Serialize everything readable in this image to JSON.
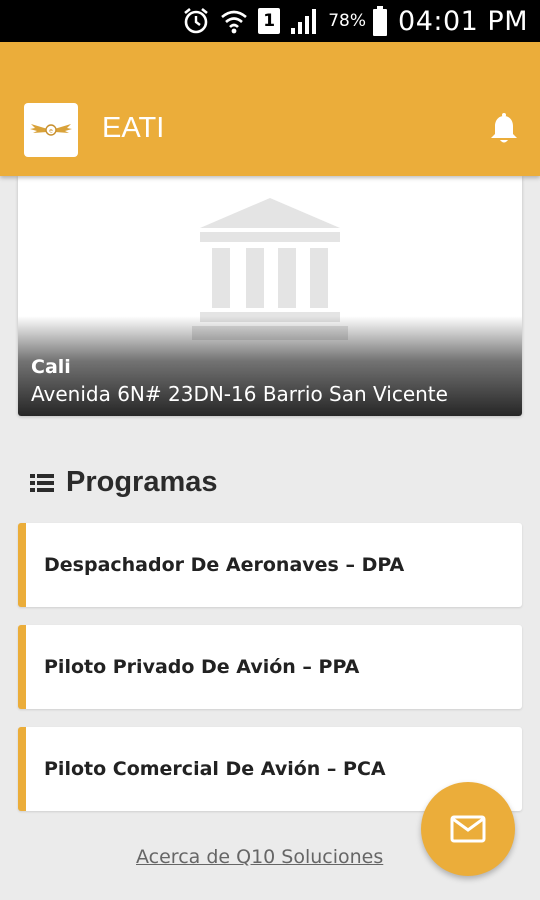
{
  "status_bar": {
    "battery_percent": "78%",
    "sim_slot": "1",
    "time": "04:01 PM",
    "icons": [
      "alarm-icon",
      "wifi-icon",
      "sim-icon",
      "signal-icon",
      "battery-icon"
    ]
  },
  "app_bar": {
    "title": "EATI",
    "logo": "eati-wings-logo",
    "notification_icon": "bell-icon",
    "color": "#ebad3a"
  },
  "location": {
    "image_icon": "institution-building-icon",
    "city": "Cali",
    "address": "Avenida 6N# 23DN-16 Barrio San Vicente"
  },
  "programs": {
    "heading_icon": "list-icon",
    "heading": "Programas",
    "items": [
      {
        "label": "Despachador De Aeronaves – DPA"
      },
      {
        "label": "Piloto Privado De Avión – PPA"
      },
      {
        "label": "Piloto Comercial De Avión – PCA"
      }
    ]
  },
  "footer": {
    "about_link": "Acerca de Q10 Soluciones"
  },
  "fab": {
    "icon": "mail-icon"
  },
  "colors": {
    "accent": "#ebad3a",
    "background": "#ebebeb"
  }
}
